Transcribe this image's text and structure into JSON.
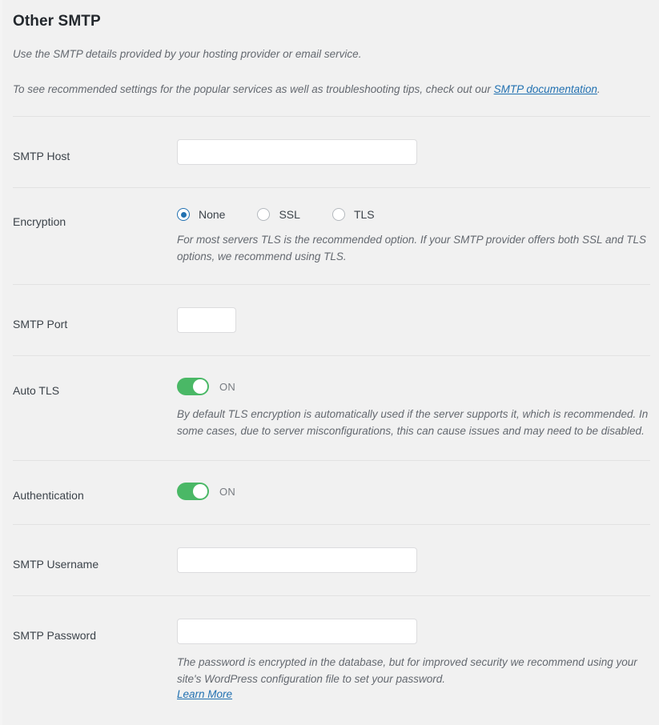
{
  "section": {
    "title": "Other SMTP",
    "description_1": "Use the SMTP details provided by your hosting provider or email service.",
    "description_2_prefix": "To see recommended settings for the popular services as well as troubleshooting tips, check out our ",
    "description_2_link": "SMTP documentation",
    "description_2_suffix": "."
  },
  "colors": {
    "page_background": "#f1f1f1",
    "link": "#2271b1",
    "toggle_on": "#4ab866",
    "radio_selected": "#2271b1",
    "title_text": "#23282d",
    "label_text": "#3c434a",
    "description_text": "#646970",
    "divider": "#e2e2e2",
    "input_border": "#dcdcde"
  },
  "fields": {
    "smtp_host": {
      "label": "SMTP Host",
      "value": "",
      "placeholder": ""
    },
    "encryption": {
      "label": "Encryption",
      "selected": "None",
      "options": [
        {
          "label": "None",
          "checked": true
        },
        {
          "label": "SSL",
          "checked": false
        },
        {
          "label": "TLS",
          "checked": false
        }
      ],
      "description": "For most servers TLS is the recommended option. If your SMTP provider offers both SSL and TLS options, we recommend using TLS."
    },
    "smtp_port": {
      "label": "SMTP Port",
      "value": "",
      "placeholder": ""
    },
    "auto_tls": {
      "label": "Auto TLS",
      "state": "ON",
      "enabled": true,
      "description": "By default TLS encryption is automatically used if the server supports it, which is recommended. In some cases, due to server misconfigurations, this can cause issues and may need to be disabled."
    },
    "authentication": {
      "label": "Authentication",
      "state": "ON",
      "enabled": true
    },
    "smtp_username": {
      "label": "SMTP Username",
      "value": "",
      "placeholder": ""
    },
    "smtp_password": {
      "label": "SMTP Password",
      "value": "",
      "placeholder": "",
      "description": "The password is encrypted in the database, but for improved security we recommend using your site's WordPress configuration file to set your password.",
      "learn_more": "Learn More"
    }
  }
}
